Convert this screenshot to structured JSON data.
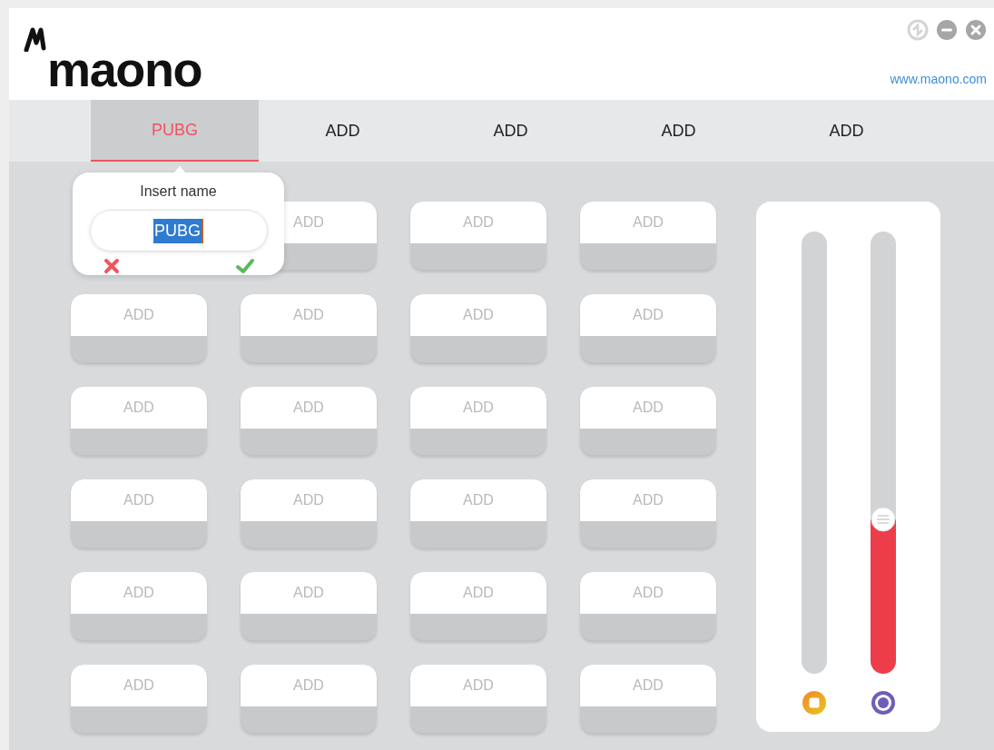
{
  "header": {
    "logo": "maono",
    "website": "www.maono.com"
  },
  "tabs": [
    {
      "label": "PUBG",
      "selected": true
    },
    {
      "label": "ADD",
      "selected": false
    },
    {
      "label": "ADD",
      "selected": false
    },
    {
      "label": "ADD",
      "selected": false
    },
    {
      "label": "ADD",
      "selected": false
    }
  ],
  "rename_popup": {
    "title": "Insert name",
    "value": "PUBG"
  },
  "pads": [
    "ADD",
    "ADD",
    "ADD",
    "ADD",
    "ADD",
    "ADD",
    "ADD",
    "ADD",
    "ADD",
    "ADD",
    "ADD",
    "ADD",
    "ADD",
    "ADD",
    "ADD",
    "ADD",
    "ADD",
    "ADD",
    "ADD",
    "ADD",
    "ADD",
    "ADD",
    "ADD"
  ],
  "sliders": [
    {
      "kind": "square"
    },
    {
      "level": 0.35,
      "kind": "target"
    }
  ]
}
